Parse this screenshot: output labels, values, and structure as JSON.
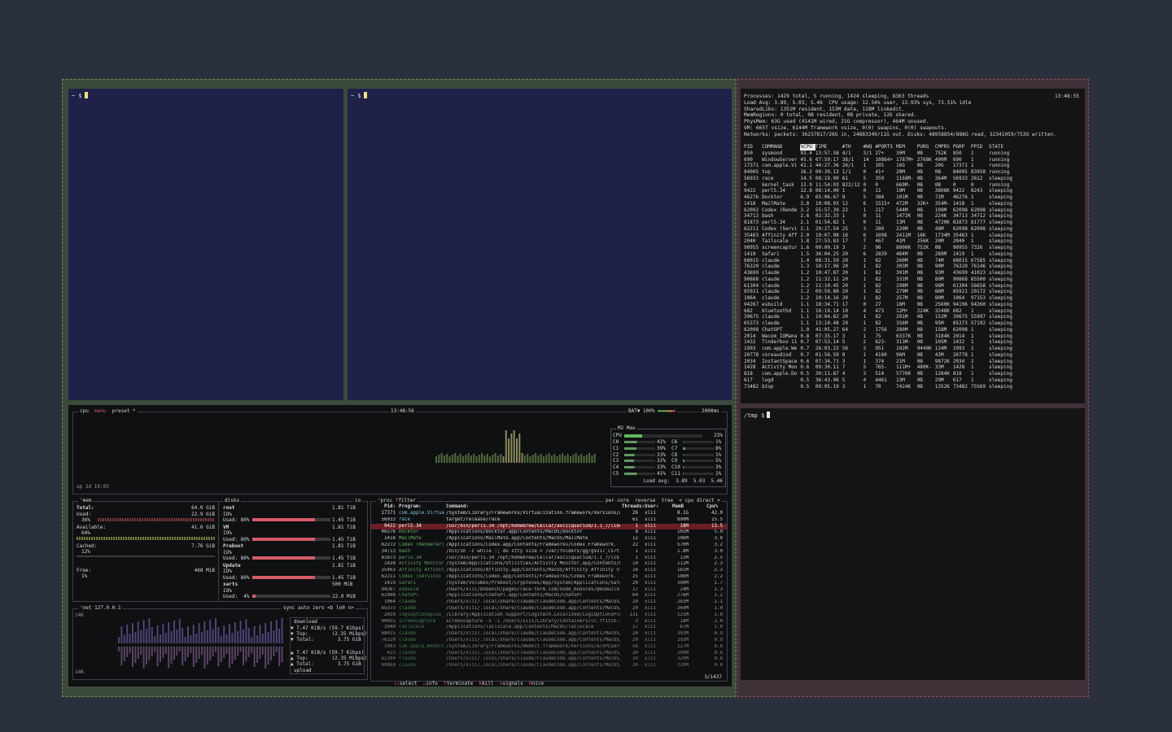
{
  "term_left_top": {
    "prompt": "~  $"
  },
  "term_mid_top": {
    "prompt": "~  $"
  },
  "term_tmp": {
    "prompt": "/tmp  $"
  },
  "top_output": {
    "time": "13:48:55",
    "summary": [
      "Processes: 1429 total, 5 running, 1424 sleeping, 8363 threads",
      "Load Avg: 3.89, 5.03, 5.46  CPU usage: 12.54% user, 13.93% sys, 73.51% idle",
      "SharedLibs: 1351M resident, 153M data, 118M linkedit.",
      "MemRegions: 0 total, 0B resident, 0B private, 12G shared.",
      "PhysMem: 63G used (4141M wired, 21G compressor), 464M unused.",
      "VM: 665T vsize, 6144M framework vsize, 0(0) swapins, 0(0) swapouts.",
      "Networks: packets: 36237817/26G in, 24883349/11G out. Disks: 48958854/886G read, 32341059/753G written."
    ],
    "columns": [
      "PID",
      "COMMAND",
      "%CPU",
      "TIME",
      "#TH",
      "#WQ",
      "#PORTS",
      "MEM",
      "PURG",
      "CMPRS",
      "PGRP",
      "PPID",
      "STATE"
    ],
    "rows": [
      [
        "850",
        "sysmond",
        "93.4",
        "13:57.58",
        "4/1",
        "3/1",
        "27+",
        "30M",
        "0B",
        "752K",
        "850",
        "1",
        "running"
      ],
      [
        "690",
        "WindowServer",
        "45.6",
        "07:59:17",
        "38/1",
        "14",
        "10864+",
        "1787M+",
        "2768K",
        "400M",
        "690",
        "1",
        "running"
      ],
      [
        "17371",
        "com.apple.Vi",
        "41.1",
        "44:27.36",
        "26/1",
        "1",
        "105",
        "16G",
        "0B",
        "20G",
        "17371",
        "1",
        "running"
      ],
      [
        "84005",
        "top",
        "16.2",
        "00:30.13",
        "1/1",
        "0",
        "41+",
        "20M",
        "0B",
        "0B",
        "84005",
        "83958",
        "running"
      ],
      [
        "56933",
        "race",
        "14.5",
        "08:19.90",
        "61",
        "5",
        "359",
        "1168M-",
        "0B",
        "364M",
        "56933",
        "2612",
        "sleeping"
      ],
      [
        "0",
        "kernel_task",
        "13.9",
        "11:54:03",
        "822/12",
        "0",
        "0",
        "669M-",
        "0B",
        "0B",
        "0",
        "0",
        "running"
      ],
      [
        "9422",
        "perl5.34",
        "12.8",
        "08:14.00",
        "1",
        "0",
        "11",
        "19M",
        "0B",
        "3808K",
        "9422",
        "8243",
        "sleeping"
      ],
      [
        "46276",
        "Docktor",
        "6.9",
        "65:06.67",
        "8",
        "5",
        "384",
        "101M",
        "0B",
        "72M",
        "46276",
        "1",
        "sleeping"
      ],
      [
        "1418",
        "MailMate",
        "3.8",
        "10:08.93",
        "12",
        "6",
        "1515+",
        "472M",
        "32K+",
        "354M-",
        "1418",
        "1",
        "sleeping"
      ],
      [
        "62092",
        "Codex (Rende",
        "3.2",
        "55:57.39",
        "22",
        "1",
        "217",
        "544M",
        "0B",
        "109M",
        "62098",
        "62098",
        "sleeping"
      ],
      [
        "34713",
        "bash",
        "2.6",
        "02:32.33",
        "1",
        "0",
        "11",
        "1472K",
        "0B",
        "224K",
        "34713",
        "34712",
        "sleeping"
      ],
      [
        "81873",
        "perl5.34",
        "2.1",
        "01:54.82",
        "1",
        "0",
        "11",
        "13M",
        "0B",
        "4720K",
        "81873",
        "81777",
        "sleeping"
      ],
      [
        "62211",
        "Codex (Servi",
        "2.1",
        "29:27.54",
        "25",
        "3",
        "280",
        "220M",
        "0B",
        "48M",
        "62098",
        "62098",
        "sleeping"
      ],
      [
        "35463",
        "Affinity Aff",
        "2.0",
        "19:07.08",
        "16",
        "6",
        "1098",
        "2411M",
        "16K",
        "1734M",
        "35463",
        "1",
        "sleeping"
      ],
      [
        "2040",
        "Tailscale",
        "1.8",
        "27:53.83",
        "17",
        "7",
        "467",
        "41M",
        "256K",
        "20M",
        "2040",
        "1",
        "sleeping"
      ],
      [
        "90955",
        "screencaptur",
        "1.6",
        "00:00.19",
        "3",
        "2",
        "96",
        "8800K",
        "752K",
        "0B",
        "90955",
        "7326",
        "sleeping"
      ],
      [
        "1419",
        "Safari",
        "1.5",
        "36:04.25",
        "20",
        "6",
        "2839",
        "484M",
        "0B",
        "289M",
        "1419",
        "1",
        "sleeping"
      ],
      [
        "68015",
        "claude",
        "1.4",
        "08:31.59",
        "20",
        "1",
        "82",
        "260M",
        "0B",
        "74M",
        "68015",
        "67585",
        "sleeping"
      ],
      [
        "76320",
        "claude",
        "1.3",
        "10:17.96",
        "20",
        "1",
        "82",
        "303M",
        "0B",
        "90M",
        "76320",
        "76146",
        "sleeping"
      ],
      [
        "43699",
        "claude",
        "1.2",
        "10:47.87",
        "20",
        "1",
        "82",
        "301M",
        "0B",
        "93M",
        "43699",
        "41023",
        "sleeping"
      ],
      [
        "90868",
        "claude",
        "1.2",
        "11:32.11",
        "20",
        "1",
        "82",
        "331M",
        "0B",
        "80M",
        "90868",
        "85500",
        "sleeping"
      ],
      [
        "61304",
        "claude",
        "1.2",
        "11:10.45",
        "20",
        "1",
        "82",
        "298M",
        "0B",
        "98M",
        "61304",
        "56658",
        "sleeping"
      ],
      [
        "85921",
        "claude",
        "1.2",
        "09:59.80",
        "20",
        "1",
        "82",
        "279M",
        "0B",
        "86M",
        "85921",
        "20172",
        "sleeping"
      ],
      [
        "1064",
        "claude",
        "1.2",
        "10:14.16",
        "20",
        "1",
        "82",
        "257M",
        "0B",
        "80M",
        "1064",
        "97153",
        "sleeping"
      ],
      [
        "94267",
        "esbuild",
        "1.1",
        "18:34.71",
        "17",
        "0",
        "27",
        "16M",
        "0B",
        "2560K",
        "94196",
        "94260",
        "sleeping"
      ],
      [
        "682",
        "bluetoothd",
        "1.1",
        "16:19.14",
        "10",
        "4",
        "473",
        "12M+",
        "224K",
        "3248K",
        "682",
        "1",
        "sleeping"
      ],
      [
        "39675",
        "claude",
        "1.1",
        "10:04.82",
        "20",
        "1",
        "82",
        "291M",
        "0B",
        "152M",
        "39675",
        "55997",
        "sleeping"
      ],
      [
        "65373",
        "claude",
        "1.1",
        "13:10.48",
        "20",
        "1",
        "82",
        "356M",
        "0B",
        "95M",
        "65373",
        "57192",
        "sleeping"
      ],
      [
        "62098",
        "ChatGPT",
        "1.0",
        "41:05.27",
        "64",
        "2",
        "1756",
        "280M",
        "0B",
        "158M",
        "62098",
        "1",
        "sleeping"
      ],
      [
        "2014",
        "Wacom_IOMana",
        "0.8",
        "07:35.17",
        "3",
        "1",
        "75",
        "6337K",
        "0B",
        "3184K",
        "2014",
        "1",
        "sleeping"
      ],
      [
        "1432",
        "Tinderbox 11",
        "0.7",
        "07:53.14",
        "5",
        "2",
        "623-",
        "313M-",
        "0B",
        "105M",
        "1432",
        "1",
        "sleeping"
      ],
      [
        "1993",
        "com.apple.We",
        "0.7",
        "26:03.23",
        "56",
        "2",
        "951",
        "192M",
        "9440K",
        "134M",
        "1993",
        "1",
        "sleeping"
      ],
      [
        "20778",
        "coreaudiod",
        "0.7",
        "01:56.59",
        "8",
        "1",
        "4160",
        "96M",
        "0B",
        "43M",
        "20778",
        "1",
        "sleeping"
      ],
      [
        "2034",
        "InstantSpace",
        "0.6",
        "07:34.71",
        "3",
        "1",
        "374",
        "21M",
        "0B",
        "9872K",
        "2034",
        "1",
        "sleeping"
      ],
      [
        "1428",
        "Activity Mon",
        "0.6",
        "09:30.11",
        "7",
        "5",
        "765-",
        "111M+",
        "480K-",
        "33M",
        "1428",
        "1",
        "sleeping"
      ],
      [
        "818",
        "com.apple.Do",
        "0.5",
        "30:11.87",
        "4",
        "3",
        "514",
        "5776K",
        "0B",
        "1264K",
        "818",
        "1",
        "sleeping"
      ],
      [
        "617",
        "logd",
        "0.5",
        "36:43.96",
        "5",
        "4",
        "4461",
        "13M",
        "0B",
        "29M",
        "617",
        "1",
        "sleeping"
      ],
      [
        "73482",
        "btop",
        "0.5",
        "09:05.19",
        "3",
        "1",
        "70",
        "7424K",
        "0B",
        "1352K",
        "73482",
        "75569",
        "sleeping"
      ]
    ]
  },
  "btop": {
    "header": {
      "cpu": "cpu",
      "menu": "menu",
      "preset": "preset *",
      "time": "13:48:56",
      "battery": "BAT▼ 100%",
      "interval": "2000ms"
    },
    "uptime": "up 3d 19:03",
    "cpu_box": {
      "title": "M2 Max",
      "total_label": "CPU",
      "total_pct": "23%",
      "cores": [
        {
          "l": "C0",
          "v": "41%"
        },
        {
          "l": "C6",
          "v": "1%"
        },
        {
          "l": "C1",
          "v": "39%"
        },
        {
          "l": "C7",
          "v": "8%"
        },
        {
          "l": "C2",
          "v": "33%"
        },
        {
          "l": "C8",
          "v": "1%"
        },
        {
          "l": "C3",
          "v": "32%"
        },
        {
          "l": "C9",
          "v": "5%"
        },
        {
          "l": "C4",
          "v": "33%"
        },
        {
          "l": "C10",
          "v": "3%"
        },
        {
          "l": "C5",
          "v": "41%"
        },
        {
          "l": "C11",
          "v": "1%"
        }
      ],
      "load": "Load avg:  3.89  5.03  5.46"
    },
    "mem": {
      "title": "mem",
      "total_label": "Total:",
      "total": "64.0 GiB",
      "used_label": "Used:",
      "used": "22.9 GiB",
      "used_pct": "36%",
      "avail_label": "Available:",
      "avail": "41.0 GiB",
      "avail_pct": "64%",
      "cached_label": "Cached:",
      "cached": "7.76 GiB",
      "cached_pct": "12%",
      "free_label": "Free:",
      "free": "468 MiB",
      "free_pct": "1%"
    },
    "disks": {
      "title": "disks",
      "io": "io",
      "items": [
        {
          "name": "root",
          "size": "1.81 TiB",
          "io": "IO%",
          "used": "Used: 80%",
          "free": "1.45 TiB"
        },
        {
          "name": "VM",
          "size": "1.81 TiB",
          "io": "IO%",
          "used": "Used: 80%",
          "free": "1.45 TiB"
        },
        {
          "name": "Preboot",
          "size": "1.81 TiB",
          "io": "IO%",
          "used": "Used: 80%",
          "free": "1.45 TiB"
        },
        {
          "name": "Update",
          "size": "1.81 TiB",
          "io": "IO%",
          "used": "Used: 80%",
          "free": "1.45 TiB"
        },
        {
          "name": "xarts",
          "size": "500 MiB",
          "io": "IO%",
          "used": "Used:  4%",
          "free": "22.0 MiB"
        }
      ]
    },
    "net": {
      "title": "net",
      "ip": "127.0.0.1",
      "opts": "sync auto zero <b lo0 n>",
      "scale_top": "14K",
      "scale_bot": "14K",
      "download": "download",
      "dl_rate": "▼ 7.47 KiB/s (59.7 Kibps)",
      "dl_top": "▼ Top:        (2.35 Mibps)",
      "dl_total": "▼ Total:        3.75 GiB",
      "ul_rate": "▲ 7.47 KiB/s (59.7 Kibps)",
      "ul_top": "▲ Top:        (2.35 Mibps)",
      "ul_total": "▲ Total:        3.75 GiB",
      "upload": "upload"
    },
    "proc": {
      "title": "proc",
      "filter": "filter",
      "opts": "per-core  reverse  tree  < cpu direct >",
      "headers": {
        "pid": "Pid:",
        "program": "Program:",
        "command": "Command:",
        "threads": "Threads:",
        "user": "User:",
        "mem": "MemB",
        "cpu": "Cpu%"
      },
      "rows": [
        [
          "17371",
          "com.apple.Virtua",
          "/System/Library/Frameworks/Virtualization.framework/Versions/A",
          "26",
          "xlii",
          "8.1G",
          "42.0"
        ],
        [
          "56933",
          "race",
          "target/release/race",
          "61",
          "xlii",
          "899M",
          "15.5"
        ],
        [
          "9422",
          "perl5.34",
          "/usr/bin/perl5.34 /opt/homebrew/Cellar/asciiquarium/1.1_7/libe",
          "1",
          "xlii",
          "18M",
          "13.5"
        ],
        [
          "46276",
          "Docktor",
          "/Applications/Docktor.app/Contents/MacOS/Docktor",
          "8",
          "xlii",
          "101M",
          "5.9"
        ],
        [
          "1418",
          "MailMate",
          "/Applications/MailMate.app/Contents/MacOS/MailMate",
          "12",
          "xlii",
          "196M",
          "3.8"
        ],
        [
          "62272",
          "Codex (Renderer)",
          "/Applications/Codex.app/Contents/Frameworks/Codex Framework.",
          "22",
          "xlii",
          "570M",
          "3.2"
        ],
        [
          "34713",
          "bash",
          "/bin/sh -c while :; do stty size > /var/folders/gg/g9217_cs7t1",
          "1",
          "xlii",
          "1.8M",
          "3.0"
        ],
        [
          "81873",
          "perl5.34",
          "/usr/bin/perl5.34 /opt/homebrew/Cellar/asciiquarium/1.1_7/lib",
          "1",
          "xlii",
          "11M",
          "2.5"
        ],
        [
          "1428",
          "Activity Monitor",
          "/System/Applications/Utilities/Activity Monitor.app/Contents/M",
          "10",
          "xlii",
          "112M",
          "2.3"
        ],
        [
          "35463",
          "Affinity Affinit",
          "/Applications/Affinity.app/Contents/MacOS/Affinity Affinity St",
          "16",
          "xlii",
          "181M",
          "2.3"
        ],
        [
          "62211",
          "Codex (Service)",
          "/Applications/Codex.app/Contents/Frameworks/Codex Framework.",
          "25",
          "xlii",
          "186M",
          "2.2"
        ],
        [
          "1419",
          "Safari",
          "/System/Volumes/Preboot/Cryptexes/App/System/Applications/Safa",
          "20",
          "xlii",
          "300M",
          "1.7"
        ],
        [
          "94267",
          "esbuild",
          "/Users/xlii/Dnbench/pages/race-term.com/node_modules/@esbuild",
          "17",
          "xlii",
          "24M",
          "1.3"
        ],
        [
          "62098",
          "ChatGPT",
          "/Applications/ChatGPT.app/Contents/MacOS/ChatGPT",
          "64",
          "xlii",
          "276M",
          "1.2"
        ],
        [
          "1064",
          "claude",
          "/Users/xlii/.local/share/claude/ClaudeCode.app/Contents/MacOS/",
          "20",
          "xlii",
          "283M",
          "1.1"
        ],
        [
          "65373",
          "claude",
          "/Users/xlii/.local/share/claude/ClaudeCode.app/Contents/MacOS/",
          "20",
          "xlii",
          "369M",
          "1.0"
        ],
        [
          "2019",
          "logioptionsplus_",
          "/Library/Application Support/Logitech.Localized/LogiOptionsPlu",
          "131",
          "xlii",
          "121M",
          "1.0"
        ],
        [
          "90955",
          "screencapture",
          "screencapture -x -i /Users/xlii/Library/Containers/cc.ffitch.s",
          "3",
          "xlii",
          "18M",
          "1.0"
        ],
        [
          "2040",
          "Tailscale",
          "/Applications/Tailscale.app/Contents/MacOS/Tailscale",
          "17",
          "xlii",
          "67M",
          "1.0"
        ],
        [
          "68015",
          "claude",
          "/Users/xlii/.local/share/claude/ClaudeCode.app/Contents/MacOS/",
          "20",
          "xlii",
          "302M",
          "0.9"
        ],
        [
          "76320",
          "claude",
          "/Users/xlii/.local/share/claude/ClaudeCode.app/Contents/MacOS/",
          "20",
          "xlii",
          "293M",
          "0.9"
        ],
        [
          "1993",
          "com.apple.WebKit",
          "/System/Library/Frameworks/WebKit.framework/Versions/A/XPCServ",
          "56",
          "xlii",
          "127M",
          "0.8"
        ],
        [
          "423",
          "claude",
          "/Users/xlii/.local/share/claude/ClaudeCode.app/Contents/MacOS/",
          "20",
          "xlii",
          "209M",
          "0.8"
        ],
        [
          "61304",
          "claude",
          "/Users/xlii/.local/share/claude/ClaudeCode.app/Contents/MacOS/",
          "20",
          "xlii",
          "320M",
          "0.8"
        ],
        [
          "90868",
          "claude",
          "/Users/xlii/.local/share/claude/ClaudeCode.app/Contents/MacOS/",
          "20",
          "xlii",
          "220M",
          "0.8"
        ]
      ],
      "footer": {
        "select": "select",
        "info": "info",
        "terminate": "terminate",
        "kill": "kill",
        "signals": "signals",
        "nice": "nice",
        "count": "3/1437"
      }
    }
  },
  "colors": {
    "left_group_border": "#5f8a4e",
    "right_group_border": "#8c4b56",
    "term_blue": "#1f2149",
    "term_dark": "#141414",
    "btop_bg": "#0f1012",
    "selected_row": "#6b1d25",
    "accent_red": "#e05560",
    "green": "#5fb85f",
    "cyan": "#7fc4d8"
  }
}
